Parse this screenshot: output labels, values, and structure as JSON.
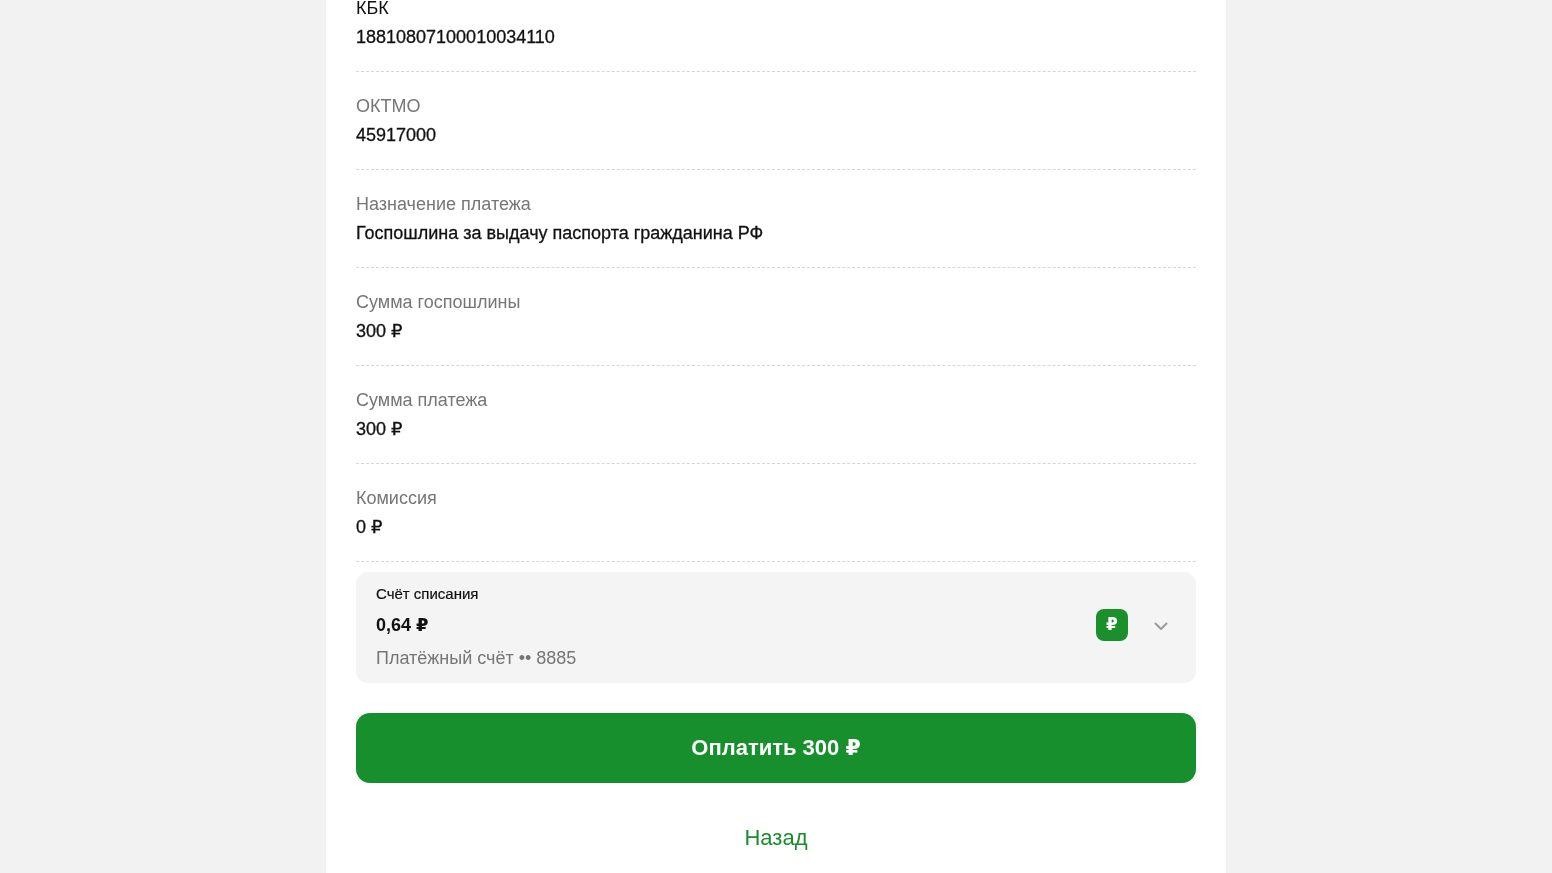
{
  "fields": [
    {
      "label": "КБК",
      "value": "18810807100010034110",
      "label_emphasized": true
    },
    {
      "label": "ОКТМО",
      "value": "45917000",
      "label_emphasized": false
    },
    {
      "label": "Назначение платежа",
      "value": "Госпошлина за выдачу паспорта гражданина РФ",
      "label_emphasized": false
    },
    {
      "label": "Сумма госпошлины",
      "value": "300 ₽",
      "label_emphasized": false
    },
    {
      "label": "Сумма платежа",
      "value": "300 ₽",
      "label_emphasized": false
    },
    {
      "label": "Комиссия",
      "value": "0 ₽",
      "label_emphasized": false
    }
  ],
  "debit_account": {
    "label": "Счёт списания",
    "balance": "0,64 ₽",
    "account": "Платёжный счёт •• 8885",
    "currency_symbol": "₽"
  },
  "pay_button": "Оплатить 300 ₽",
  "back_link": "Назад"
}
